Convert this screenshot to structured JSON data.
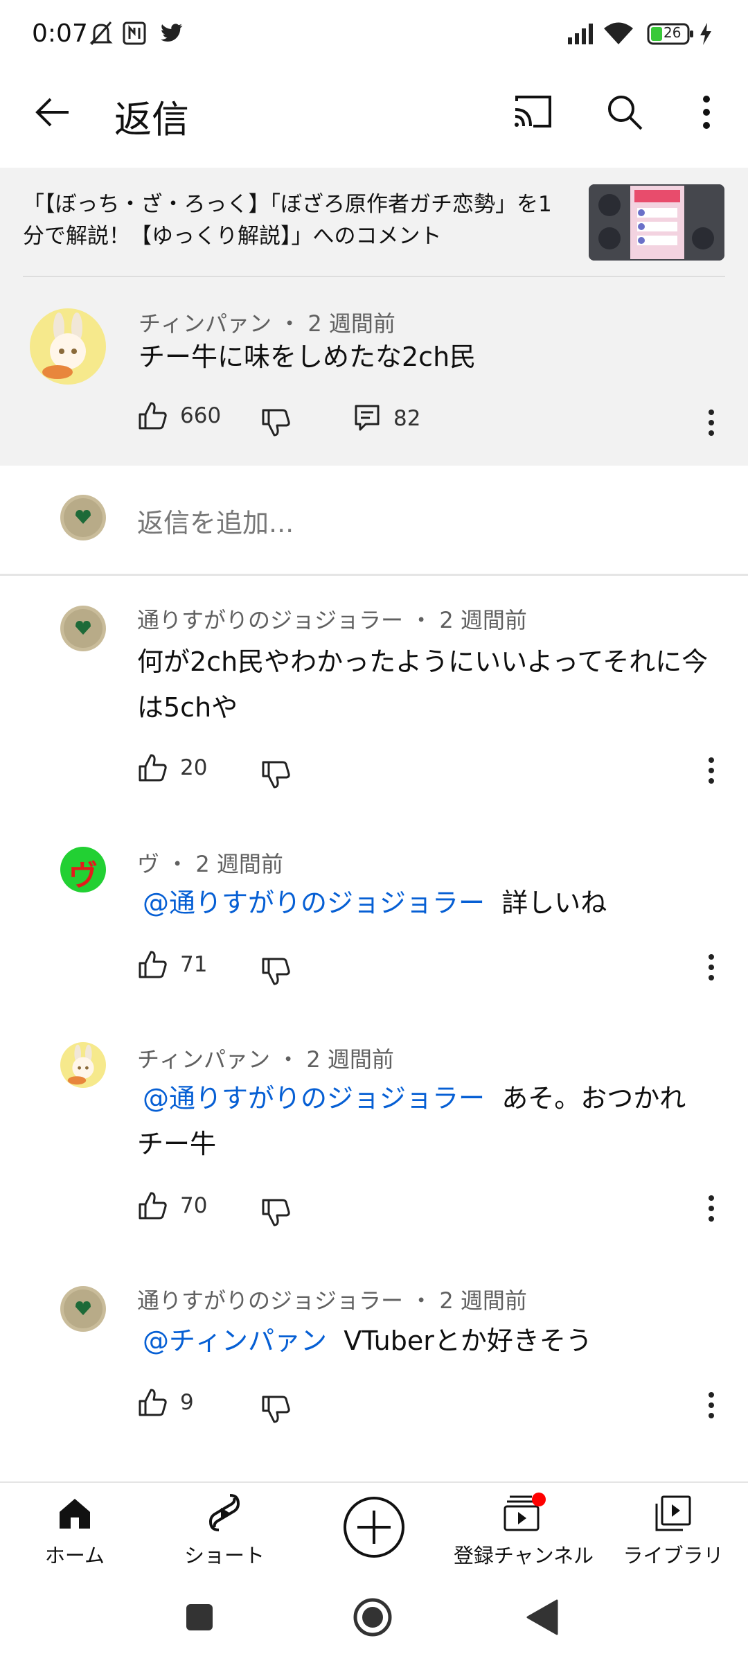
{
  "status": {
    "time": "0:07",
    "battery": "26"
  },
  "appbar": {
    "title": "返信"
  },
  "video": {
    "title": "「【ぼっち・ざ・ろっく】「ぼざろ原作者ガチ恋勢」を1分で解説！【ゆっくり解説】」へのコメント"
  },
  "parent": {
    "author": "チィンパァン ・ 2 週間前",
    "text": "チー牛に味をしめたな2ch民",
    "likes": "660",
    "replies": "82"
  },
  "add_reply": {
    "placeholder": "返信を追加..."
  },
  "replies": [
    {
      "author": "通りすがりのジョジョラー ・ 2 週間前",
      "mention": "",
      "text1": "何が2ch民やわかったようにいいよってそれに今",
      "text2": "は5chや",
      "likes": "20"
    },
    {
      "author": "ヴ ・ 2 週間前",
      "mention": "@通りすがりのジョジョラー",
      "text1": "詳しいね",
      "text2": "",
      "likes": "71"
    },
    {
      "author": "チィンパァン ・ 2 週間前",
      "mention": "@通りすがりのジョジョラー",
      "text1": "あそ。おつかれ",
      "text2": "チー牛",
      "likes": "70"
    },
    {
      "author": "通りすがりのジョジョラー ・ 2 週間前",
      "mention": "@チィンパァン",
      "text1": "VTuberとか好きそう",
      "text2": "",
      "likes": "9"
    }
  ],
  "avatar_letter": "ヴ",
  "nav": {
    "home": "ホーム",
    "shorts": "ショート",
    "subscriptions": "登録チャンネル",
    "library": "ライブラリ"
  },
  "colors": {
    "mention": "#065fd4",
    "header_bg": "#f2f2f2",
    "notification_dot": "#ff0000"
  }
}
